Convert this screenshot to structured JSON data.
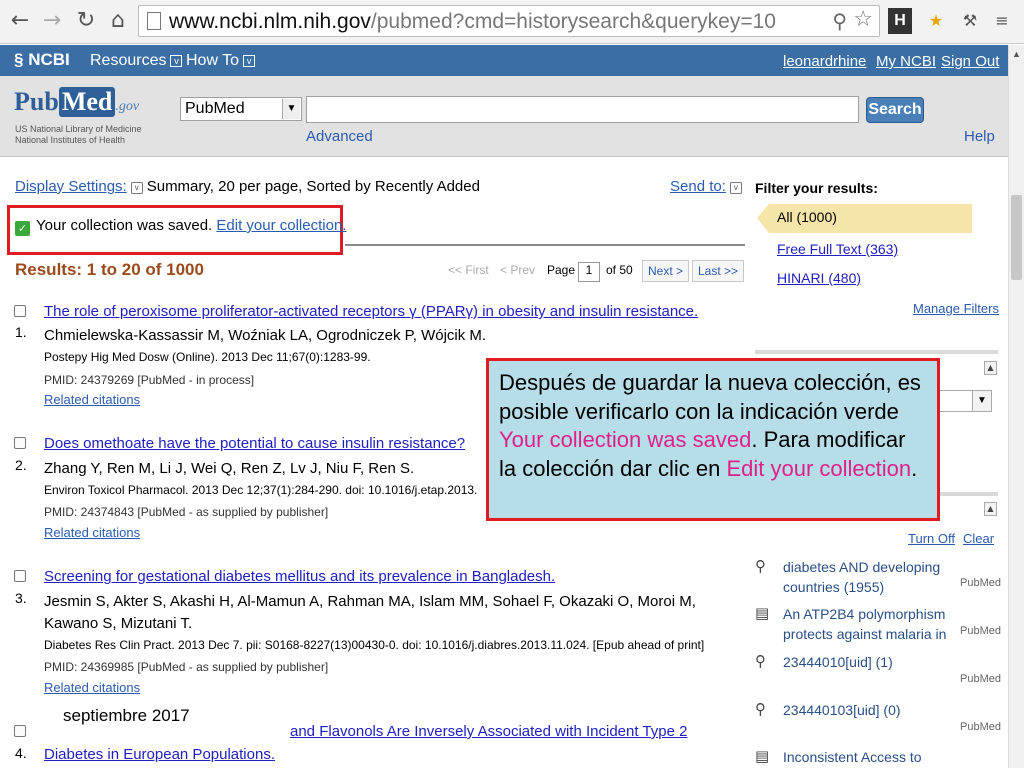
{
  "browser": {
    "url_host": "www.ncbi.nlm.nih.gov",
    "url_path": "/pubmed?cmd=historysearch&querykey=10"
  },
  "ncbi_bar": {
    "logo": "NCBI",
    "resources": "Resources",
    "how_to": "How To",
    "username": "leonardrhine",
    "my_ncbi": "My NCBI",
    "sign_out": "Sign Out"
  },
  "search": {
    "logo_pub": "Pub",
    "logo_med": "Med",
    "logo_gov": ".gov",
    "sub_line1": "US National Library of Medicine",
    "sub_line2": "National Institutes of Health",
    "database": "PubMed",
    "query": "",
    "button": "Search",
    "advanced": "Advanced",
    "help": "Help"
  },
  "results_header": {
    "display_settings": "Display Settings:",
    "display_summary": "Summary, 20 per page, Sorted by Recently Added",
    "send_to": "Send to:",
    "saved_text": "Your collection was saved.",
    "saved_link": "Edit your collection.",
    "results_count": "Results: 1 to 20 of 1000",
    "first": "<< First",
    "prev": "< Prev",
    "page_label": "Page",
    "page_value": "1",
    "of_pages": "of 50",
    "next": "Next >",
    "last": "Last >>"
  },
  "results": [
    {
      "num": "1.",
      "title": "The role of peroxisome proliferator-activated receptors γ (PPARγ) in obesity and insulin resistance.",
      "authors": "Chmielewska-Kassassir M, Woźniak LA, Ogrodniczek P, Wójcik M.",
      "cite": "Postepy Hig Med Dosw (Online). 2013 Dec 11;67(0):1283-99.",
      "pmid": "PMID: 24379269 [PubMed - in process]",
      "related": "Related citations"
    },
    {
      "num": "2.",
      "title": "Does omethoate have the potential to cause insulin resistance?",
      "authors": "Zhang Y, Ren M, Li J, Wei Q, Ren Z, Lv J, Niu F, Ren S.",
      "cite": "Environ Toxicol Pharmacol. 2013 Dec 12;37(1):284-290. doi: 10.1016/j.etap.2013.",
      "pmid": "PMID: 24374843 [PubMed - as supplied by publisher]",
      "related": "Related citations"
    },
    {
      "num": "3.",
      "title": "Screening for gestational diabetes mellitus and its prevalence in Bangladesh.",
      "authors": "Jesmin S, Akter S, Akashi H, Al-Mamun A, Rahman MA, Islam MM, Sohael F, Okazaki O, Moroi M,",
      "authors2": "Kawano S, Mizutani T.",
      "cite": "Diabetes Res Clin Pract. 2013 Dec 7. pii: S0168-8227(13)00430-0. doi: 10.1016/j.diabres.2013.11.024. [Epub ahead of print]",
      "pmid": "PMID: 24369985 [PubMed - as supplied by publisher]",
      "related": "Related citations"
    },
    {
      "num": "4.",
      "title_part": "and Flavonols Are Inversely Associated with Incident Type 2",
      "title_line2": "Diabetes in European Populations."
    }
  ],
  "filters": {
    "title": "Filter your results:",
    "all": "All (1000)",
    "free_full_text": "Free Full Text (363)",
    "hinari": "HINARI (480)",
    "manage": "Manage Filters"
  },
  "history": {
    "turn_off": "Turn Off",
    "clear": "Clear",
    "items": [
      {
        "icon": "search-icon",
        "text": "diabetes AND developing countries (1955)",
        "db": "PubMed"
      },
      {
        "icon": "document-icon",
        "text": "An ATP2B4 polymorphism protects against malaria in",
        "db": "PubMed"
      },
      {
        "icon": "search-icon",
        "text": "23444010[uid] (1)",
        "db": "PubMed"
      },
      {
        "icon": "search-icon",
        "text": "234440103[uid] (0)",
        "db": "PubMed"
      },
      {
        "icon": "document-icon",
        "text": "Inconsistent Access to Food and",
        "db": ""
      }
    ]
  },
  "callout": {
    "t1": "Después de guardar la nueva colección, es posible verificarlo con la indicación verde ",
    "t2": "Your collection was saved",
    "t3": ".  Para modificar la colección dar clic en ",
    "t4": "Edit your collection",
    "t5": "."
  },
  "footer": {
    "date": "septiembre 2017"
  },
  "colors": {
    "ncbi_bar": "#3a6ea5",
    "highlight_red": "#e01b24",
    "callout_bg": "#b7dde8",
    "callout_pink": "#e0208a",
    "results_count": "#9b4a1c"
  }
}
